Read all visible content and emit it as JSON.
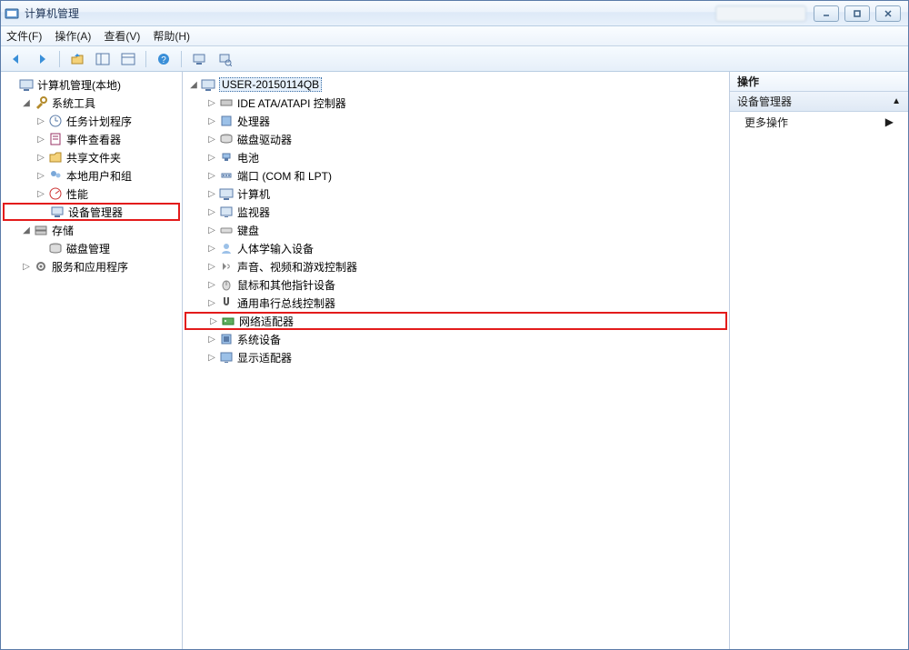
{
  "title": "计算机管理",
  "menubar": {
    "file": "文件(F)",
    "action": "操作(A)",
    "view": "查看(V)",
    "help": "帮助(H)"
  },
  "toolbar_icons": [
    "back-icon",
    "forward-icon",
    "up-icon",
    "show-hide-tree-icon",
    "properties-icon",
    "help-icon",
    "device-tree-icon",
    "scan-hardware-icon"
  ],
  "left_tree": {
    "root": "计算机管理(本地)",
    "system_tools": {
      "label": "系统工具",
      "children": [
        "任务计划程序",
        "事件查看器",
        "共享文件夹",
        "本地用户和组",
        "性能",
        "设备管理器"
      ]
    },
    "storage": {
      "label": "存储",
      "children": [
        "磁盘管理"
      ]
    },
    "services": "服务和应用程序"
  },
  "mid_tree": {
    "root": "USER-20150114QB",
    "children": [
      "IDE ATA/ATAPI 控制器",
      "处理器",
      "磁盘驱动器",
      "电池",
      "端口 (COM 和 LPT)",
      "计算机",
      "监视器",
      "键盘",
      "人体学输入设备",
      "声音、视频和游戏控制器",
      "鼠标和其他指针设备",
      "通用串行总线控制器",
      "网络适配器",
      "系统设备",
      "显示适配器"
    ]
  },
  "right": {
    "header": "操作",
    "category": "设备管理器",
    "more": "更多操作"
  }
}
